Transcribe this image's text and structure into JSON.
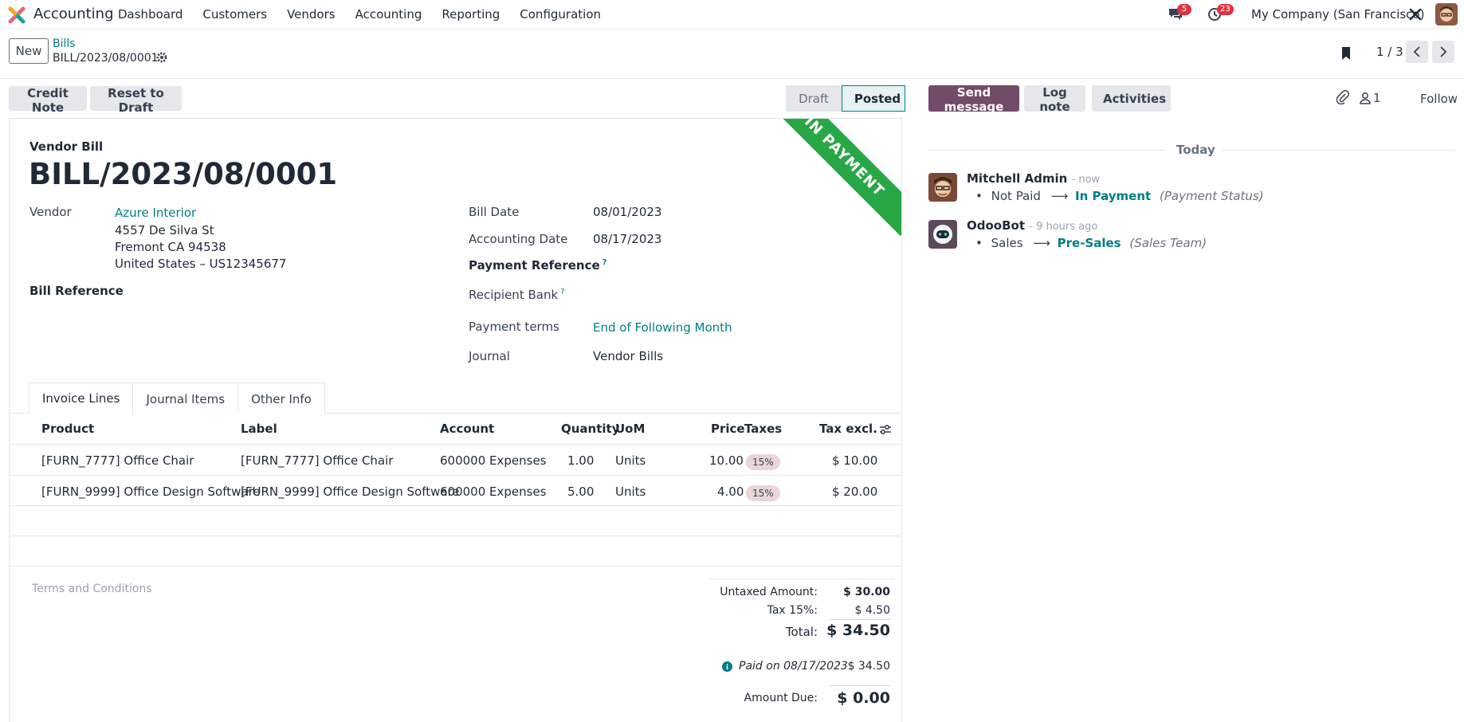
{
  "navbar": {
    "app_name": "Accounting",
    "menu": [
      "Dashboard",
      "Customers",
      "Vendors",
      "Accounting",
      "Reporting",
      "Configuration"
    ],
    "chat_badge": "5",
    "activity_badge": "23",
    "company": "My Company (San Francisco)"
  },
  "control": {
    "new_label": "New",
    "breadcrumb_parent": "Bills",
    "breadcrumb_current": "BILL/2023/08/0001",
    "pager": "1 / 3"
  },
  "actions": {
    "credit_note": "Credit Note",
    "reset_to_draft": "Reset to Draft"
  },
  "status": {
    "draft": "Draft",
    "posted": "Posted"
  },
  "ribbon": "IN PAYMENT",
  "bill": {
    "type": "Vendor Bill",
    "name": "BILL/2023/08/0001",
    "vendor_label": "Vendor",
    "vendor_name": "Azure Interior",
    "address_1": "4557 De Silva St",
    "address_2": "Fremont CA 94538",
    "address_3": "United States – US12345677",
    "bill_reference_label": "Bill Reference",
    "bill_date_label": "Bill Date",
    "bill_date": "08/01/2023",
    "accounting_date_label": "Accounting Date",
    "accounting_date": "08/17/2023",
    "payment_reference_label": "Payment Reference",
    "recipient_bank_label": "Recipient Bank",
    "payment_terms_label": "Payment terms",
    "payment_terms": "End of Following Month",
    "journal_label": "Journal",
    "journal": "Vendor Bills",
    "help_mark": "?"
  },
  "tabs": [
    "Invoice Lines",
    "Journal Items",
    "Other Info"
  ],
  "table": {
    "headers": {
      "product": "Product",
      "label": "Label",
      "account": "Account",
      "quantity": "Quantity",
      "uom": "UoM",
      "price": "Price",
      "taxes": "Taxes",
      "tax_excl": "Tax excl."
    },
    "rows": [
      {
        "product": "[FURN_7777] Office Chair",
        "label": "[FURN_7777] Office Chair",
        "account": "600000 Expenses",
        "quantity": "1.00",
        "uom": "Units",
        "price": "10.00",
        "tax": "15%",
        "subtotal": "$ 10.00"
      },
      {
        "product": "[FURN_9999] Office Design Software",
        "label": "[FURN_9999] Office Design Software",
        "account": "600000 Expenses",
        "quantity": "5.00",
        "uom": "Units",
        "price": "4.00",
        "tax": "15%",
        "subtotal": "$ 20.00"
      }
    ]
  },
  "totals": {
    "terms_placeholder": "Terms and Conditions",
    "untaxed_label": "Untaxed Amount:",
    "untaxed": "$ 30.00",
    "tax_label": "Tax 15%:",
    "tax": "$ 4.50",
    "total_label": "Total:",
    "total": "$ 34.50",
    "paid_label": "Paid on 08/17/2023",
    "paid": "$ 34.50",
    "due_label": "Amount Due:",
    "due": "$ 0.00"
  },
  "chatter": {
    "send_message": "Send message",
    "log_note": "Log note",
    "activities": "Activities",
    "followers_count": "1",
    "follow": "Follow",
    "today": "Today",
    "messages": [
      {
        "author": "Mitchell Admin",
        "time": "- now",
        "old": "Not Paid",
        "arrow": "⟶",
        "new": "In Payment",
        "field": "(Payment Status)"
      },
      {
        "author": "OdooBot",
        "time": "- 9 hours ago",
        "old": "Sales",
        "arrow": "⟶",
        "new": "Pre-Sales",
        "field": "(Sales Team)"
      }
    ]
  },
  "colors": {
    "brand": "#714b67",
    "link": "#017e84",
    "ribbon": "#28a745",
    "badge": "#e2323f"
  }
}
